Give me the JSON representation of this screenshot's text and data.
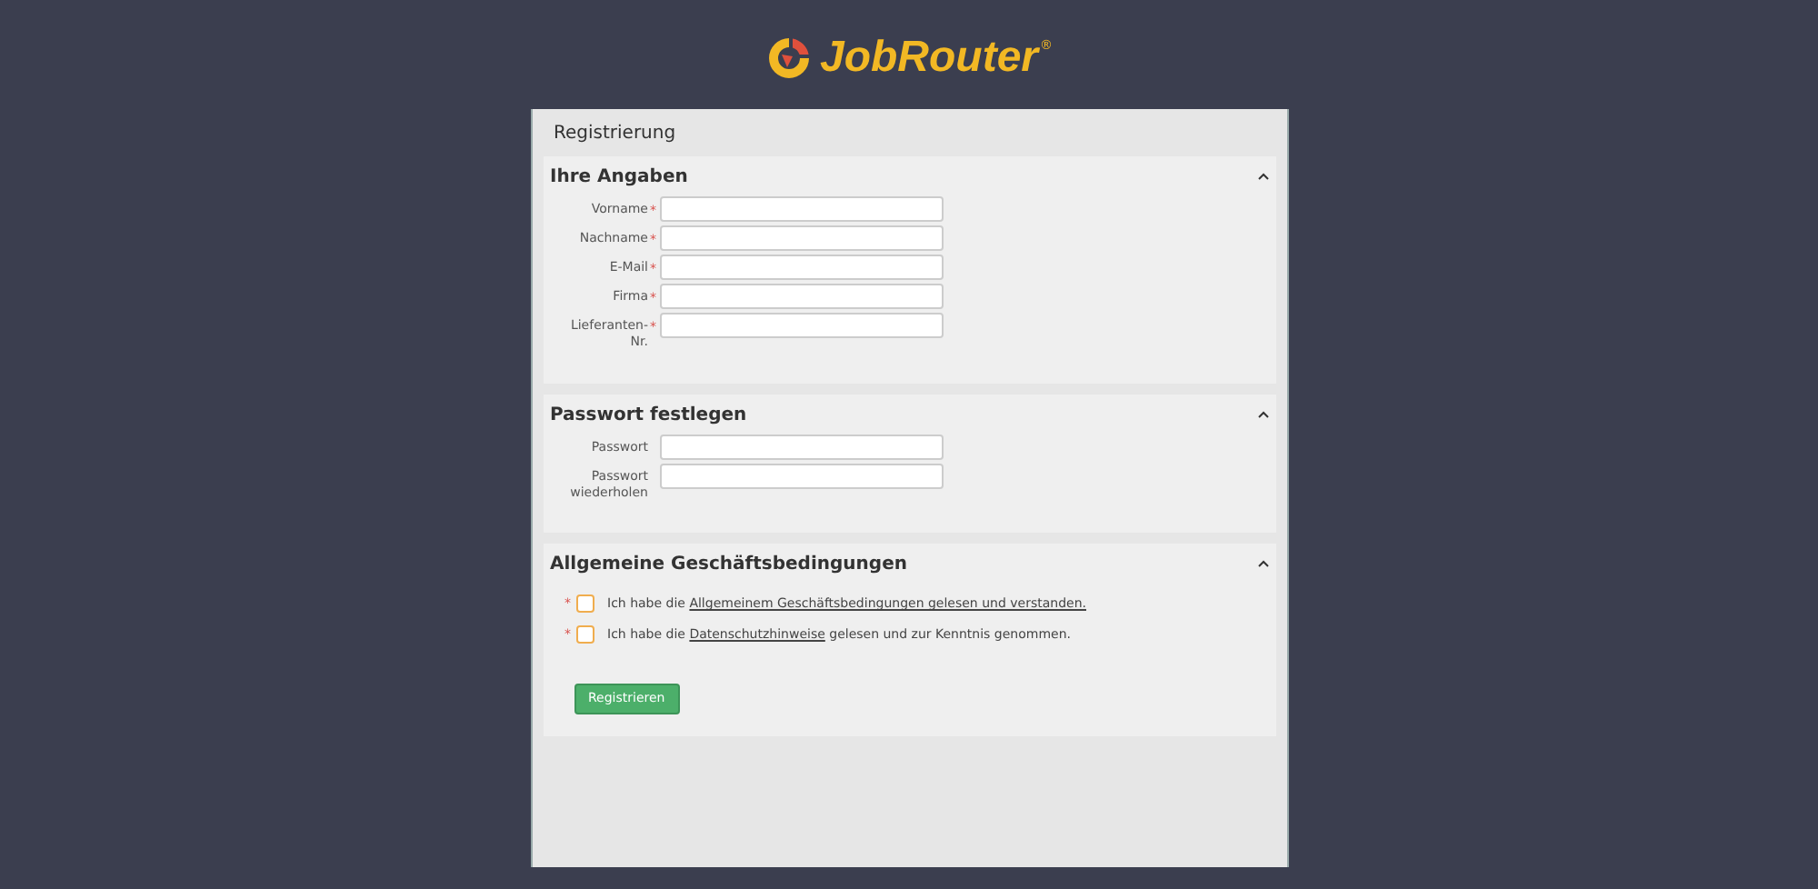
{
  "logo": {
    "name": "JobRouter",
    "mark": "®"
  },
  "panel": {
    "title": "Registrierung"
  },
  "sections": [
    {
      "title": "Ihre Angaben",
      "expanded": true,
      "fields": [
        {
          "label": "Vorname",
          "required_mark": "*"
        },
        {
          "label": "Nachname",
          "required_mark": "*"
        },
        {
          "label": "E-Mail",
          "required_mark": "*"
        },
        {
          "label": "Firma",
          "required_mark": "*"
        },
        {
          "label": "Lieferanten-Nr.",
          "required_mark": "*"
        }
      ]
    },
    {
      "title": "Passwort festlegen",
      "expanded": true,
      "fields": [
        {
          "label": "Passwort"
        },
        {
          "label": "Passwort wiederholen"
        }
      ]
    },
    {
      "title": "Allgemeine Geschäftsbedingungen",
      "expanded": true,
      "agreements": [
        {
          "required_mark": "*",
          "prefix": "Ich habe die ",
          "link": "Allgemeinem Geschäftsbedingungen gelesen und verstanden.",
          "checked": false
        },
        {
          "required_mark": "*",
          "prefix": "Ich habe die ",
          "link": "Datenschutzhinweise",
          "suffix": " gelesen und zur Kenntnis genommen.",
          "checked": false
        }
      ],
      "button": "Registrieren"
    }
  ]
}
